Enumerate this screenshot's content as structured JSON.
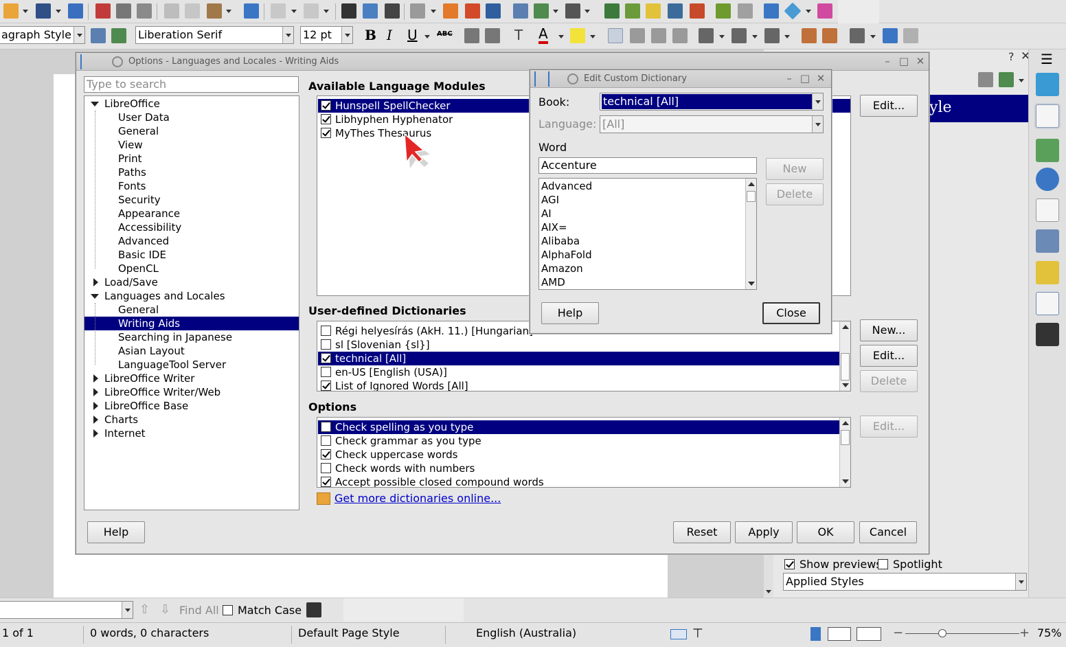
{
  "formatting": {
    "paragraph_style": "agraph Style",
    "font_name": "Liberation Serif",
    "font_size": "12 pt"
  },
  "sidebar": {
    "help_glyph": "?",
    "close_glyph": "✕",
    "menu_glyph": "☰",
    "preview_text": "yle",
    "show_previews_label": "Show previews",
    "show_previews_checked": true,
    "spotlight_label": "Spotlight",
    "spotlight_checked": false,
    "filter_value": "Applied Styles"
  },
  "findbar": {
    "find_all_label": "Find All",
    "match_case_label": "Match Case"
  },
  "statusbar": {
    "page": "1 of 1",
    "words": "0 words, 0 characters",
    "page_style": "Default Page Style",
    "language": "English (Australia)",
    "zoom": "75%"
  },
  "options_dialog": {
    "title": "Options - Languages and Locales - Writing Aids",
    "search_placeholder": "Type to search",
    "tree": [
      {
        "label": "LibreOffice",
        "level": 0,
        "expanded": true
      },
      {
        "label": "User Data",
        "level": 1
      },
      {
        "label": "General",
        "level": 1
      },
      {
        "label": "View",
        "level": 1
      },
      {
        "label": "Print",
        "level": 1
      },
      {
        "label": "Paths",
        "level": 1
      },
      {
        "label": "Fonts",
        "level": 1
      },
      {
        "label": "Security",
        "level": 1
      },
      {
        "label": "Appearance",
        "level": 1
      },
      {
        "label": "Accessibility",
        "level": 1
      },
      {
        "label": "Advanced",
        "level": 1
      },
      {
        "label": "Basic IDE",
        "level": 1
      },
      {
        "label": "OpenCL",
        "level": 1
      },
      {
        "label": "Load/Save",
        "level": 0,
        "expanded": false
      },
      {
        "label": "Languages and Locales",
        "level": 0,
        "expanded": true
      },
      {
        "label": "General",
        "level": 1
      },
      {
        "label": "Writing Aids",
        "level": 1,
        "selected": true
      },
      {
        "label": "Searching in Japanese",
        "level": 1
      },
      {
        "label": "Asian Layout",
        "level": 1
      },
      {
        "label": "LanguageTool Server",
        "level": 1
      },
      {
        "label": "LibreOffice Writer",
        "level": 0,
        "expanded": false
      },
      {
        "label": "LibreOffice Writer/Web",
        "level": 0,
        "expanded": false
      },
      {
        "label": "LibreOffice Base",
        "level": 0,
        "expanded": false
      },
      {
        "label": "Charts",
        "level": 0,
        "expanded": false
      },
      {
        "label": "Internet",
        "level": 0,
        "expanded": false
      }
    ],
    "modules_heading": "Available Language Modules",
    "modules": [
      {
        "label": "Hunspell SpellChecker",
        "checked": true,
        "selected": true
      },
      {
        "label": "Libhyphen Hyphenator",
        "checked": true
      },
      {
        "label": "MyThes Thesaurus",
        "checked": true
      }
    ],
    "modules_edit": "Edit...",
    "dicts_heading": "User-defined Dictionaries",
    "dictionaries": [
      {
        "label": "Régi helyesírás (AkH. 11.) [Hungarian]",
        "checked": false
      },
      {
        "label": "sl [Slovenian {sl}]",
        "checked": false
      },
      {
        "label": "technical [All]",
        "checked": true,
        "selected": true
      },
      {
        "label": "en-US [English (USA)]",
        "checked": false
      },
      {
        "label": "List of Ignored Words [All]",
        "checked": true
      }
    ],
    "dict_new": "New...",
    "dict_edit": "Edit...",
    "dict_delete": "Delete",
    "options_heading": "Options",
    "options": [
      {
        "label": "Check spelling as you type",
        "checked": false,
        "selected": true
      },
      {
        "label": "Check grammar as you type",
        "checked": false
      },
      {
        "label": "Check uppercase words",
        "checked": true
      },
      {
        "label": "Check words with numbers",
        "checked": false
      },
      {
        "label": "Accept possible closed compound words",
        "checked": true
      }
    ],
    "options_edit": "Edit...",
    "get_more_link": "Get more dictionaries online...",
    "help": "Help",
    "reset": "Reset",
    "apply": "Apply",
    "ok": "OK",
    "cancel": "Cancel"
  },
  "custom_dict_dialog": {
    "title": "Edit Custom Dictionary",
    "book_label": "Book:",
    "book_value": "technical [All]",
    "language_label": "Language:",
    "language_value": "[All]",
    "word_label": "Word",
    "word_value": "Accenture",
    "words": [
      "Advanced",
      "AGI",
      "AI",
      "AIX=",
      "Alibaba",
      "AlphaFold",
      "Amazon",
      "AMD"
    ],
    "new": "New",
    "delete": "Delete",
    "help": "Help",
    "close": "Close"
  },
  "colors": {
    "selection": "#000080",
    "link": "#0000cc"
  }
}
